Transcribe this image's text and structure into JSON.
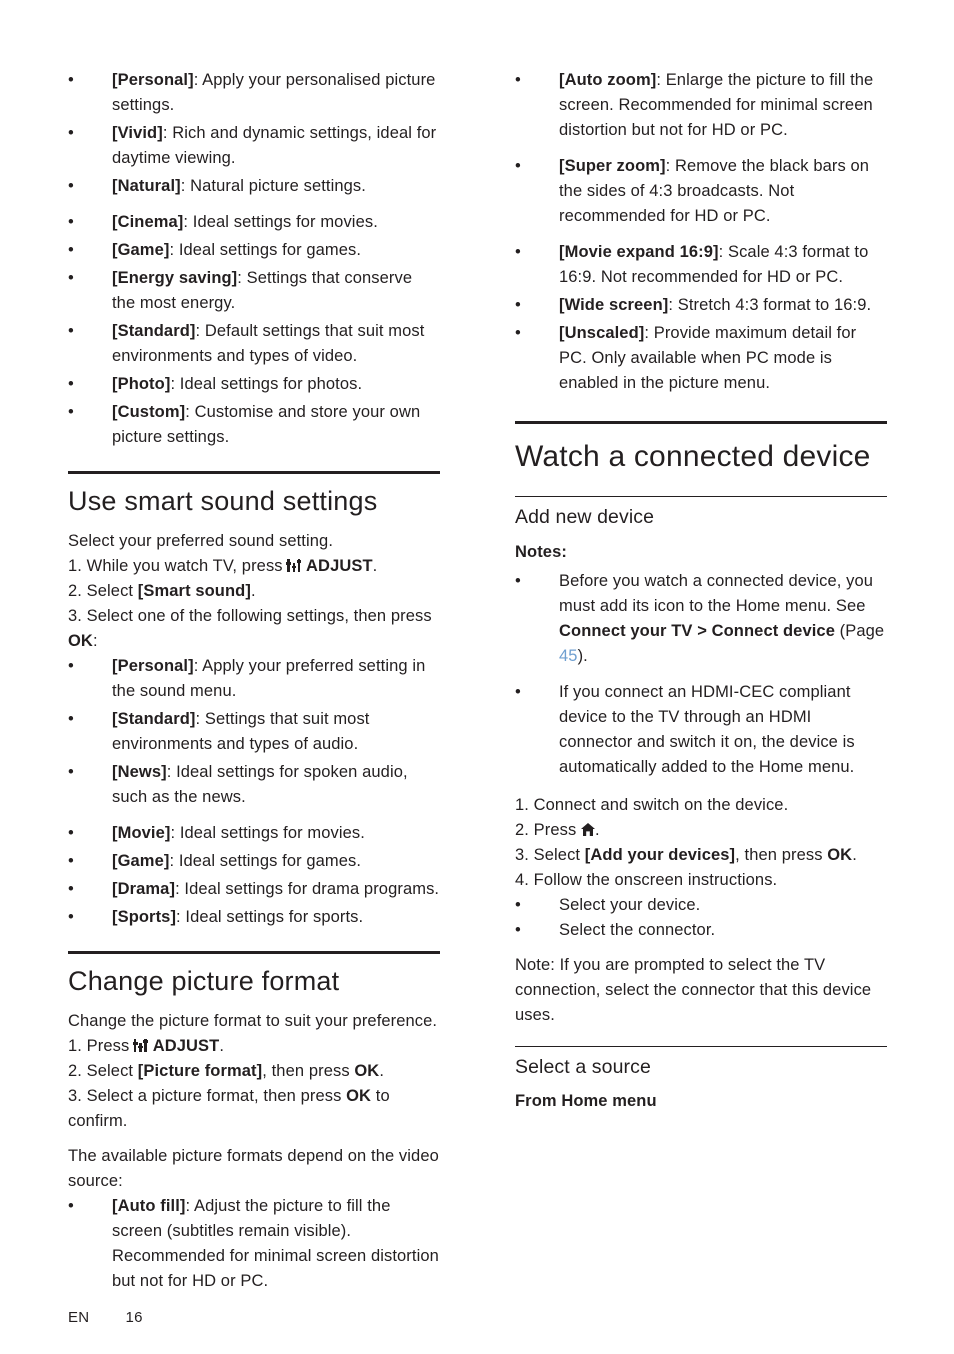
{
  "document": {
    "footer": {
      "lang": "EN",
      "page": "16"
    }
  },
  "left_column": {
    "picture_settings_list": [
      {
        "term": "[Personal]",
        "text": ": Apply your personalised picture settings."
      },
      {
        "term": "[Vivid]",
        "text": ": Rich and dynamic settings, ideal for daytime viewing."
      },
      {
        "term": "[Natural]",
        "text": ": Natural picture settings."
      },
      {
        "term": "[Cinema]",
        "text": ": Ideal settings for movies."
      },
      {
        "term": "[Game]",
        "text": ": Ideal settings for games."
      },
      {
        "term": "[Energy saving]",
        "text": ": Settings that conserve the most energy."
      },
      {
        "term": "[Standard]",
        "text": ": Default settings that suit most environments and types of video."
      },
      {
        "term": "[Photo]",
        "text": ": Ideal settings for photos."
      },
      {
        "term": "[Custom]",
        "text": ": Customise and store your own picture settings."
      }
    ],
    "smart_sound": {
      "heading": "Use smart sound settings",
      "intro": "Select your preferred sound setting.",
      "step1_pre": "1. While you watch TV, press ",
      "step1_bold": "ADJUST",
      "step1_post": ".",
      "step2_pre": "2. Select ",
      "step2_bold": "[Smart sound]",
      "step2_post": ".",
      "step3_pre": "3. Select one of the following settings, then press ",
      "step3_bold": "OK",
      "step3_post": ":",
      "items": [
        {
          "term": "[Personal]",
          "text": ": Apply your preferred setting in the sound menu."
        },
        {
          "term": "[Standard]",
          "text": ": Settings that suit most environments and types of audio."
        },
        {
          "term": "[News]",
          "text": ": Ideal settings for spoken audio, such as the news."
        },
        {
          "term": "[Movie]",
          "text": ": Ideal settings for movies."
        },
        {
          "term": "[Game]",
          "text": ": Ideal settings for games."
        },
        {
          "term": "[Drama]",
          "text": ": Ideal settings for drama programs."
        },
        {
          "term": "[Sports]",
          "text": ": Ideal settings for sports."
        }
      ]
    },
    "picture_format": {
      "heading": "Change picture format",
      "intro": "Change the picture format to suit your preference.",
      "step1_pre": "1. Press ",
      "step1_bold": "ADJUST",
      "step1_post": ".",
      "step2_pre": "2. Select ",
      "step2_bold": "[Picture format]",
      "step2_mid": ", then press ",
      "step2_bold2": "OK",
      "step2_post": ".",
      "step3_pre": "3. Select a picture format, then press ",
      "step3_bold": "OK",
      "step3_post": " to confirm.",
      "note": "The available picture formats depend on the video source:",
      "items": [
        {
          "term": "[Auto fill]",
          "text": ": Adjust the picture to fill the screen (subtitles remain visible). Recommended for minimal screen distortion but not for HD or PC."
        }
      ]
    }
  },
  "right_column": {
    "format_list": [
      {
        "term": "[Auto zoom]",
        "text": ": Enlarge the picture to fill the screen. Recommended for minimal screen distortion but not for HD or PC."
      },
      {
        "term": "[Super zoom]",
        "text": ": Remove the black bars on the sides of 4:3 broadcasts. Not recommended for HD or PC."
      },
      {
        "term": "[Movie expand 16:9]",
        "text": ": Scale 4:3 format to 16:9. Not recommended for HD or PC."
      },
      {
        "term": "[Wide screen]",
        "text": ": Stretch 4:3 format to 16:9."
      },
      {
        "term": "[Unscaled]",
        "text": ": Provide maximum detail for PC. Only available when PC mode is enabled in the picture menu."
      }
    ],
    "watch_device": {
      "heading": "Watch a connected device",
      "add_new_device": {
        "heading": "Add new device",
        "notes_label": "Notes:",
        "note1_a": "Before you watch a connected device, you must add its icon to the Home menu. See ",
        "note1_bold": "Connect your TV > Connect device",
        "note1_b": " (Page ",
        "note1_link": "45",
        "note1_c": ").",
        "note2": "If you connect an HDMI-CEC compliant device to the TV through an HDMI connector and switch it on, the device is automatically added to the Home menu.",
        "step1": "1. Connect and switch on the device.",
        "step2_pre": "2. Press ",
        "step2_post": ".",
        "step3_pre": "3. Select ",
        "step3_bold": "[Add your devices]",
        "step3_mid": ", then press ",
        "step3_bold2": "OK",
        "step3_post": ".",
        "step4": "4. Follow the onscreen instructions.",
        "bullets": [
          "Select your device.",
          "Select the connector."
        ],
        "closing_note": "Note: If you are prompted to select the TV connection, select the connector that this device uses."
      },
      "select_source": {
        "heading": "Select a source",
        "subheading": "From Home menu"
      }
    }
  }
}
